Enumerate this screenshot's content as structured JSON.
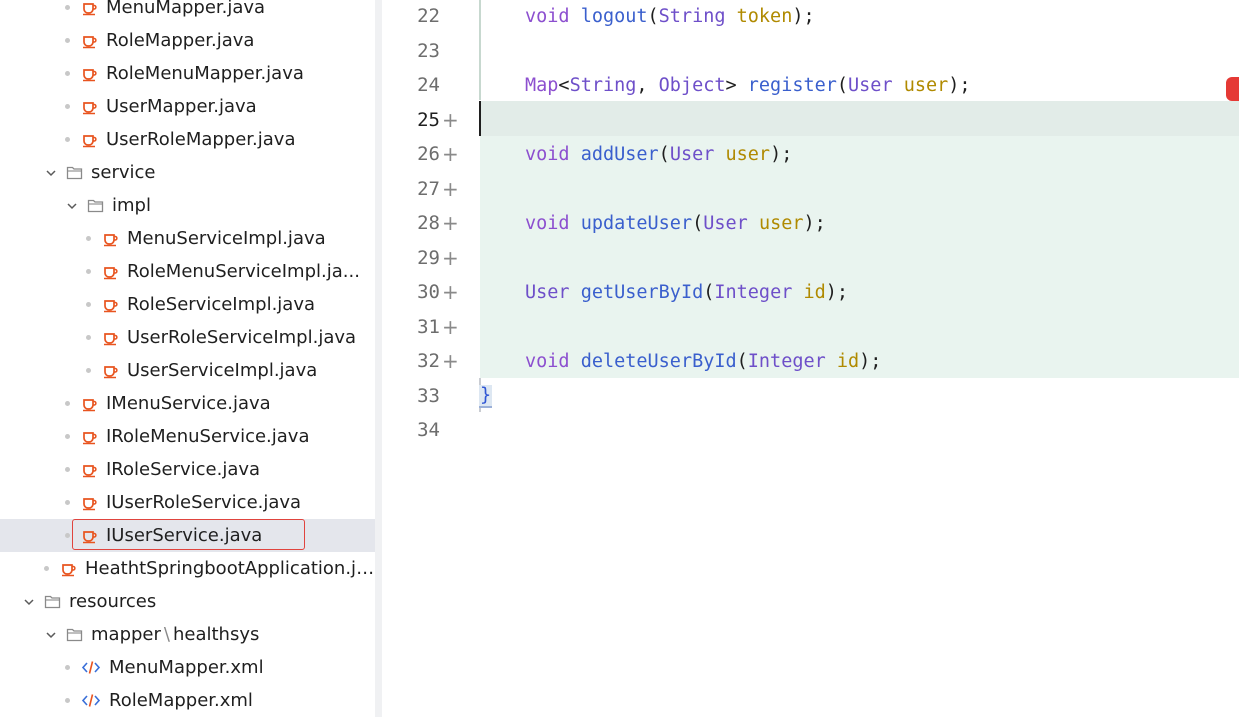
{
  "tree": {
    "items": [
      {
        "label": "MenuMapper.java",
        "type": "java",
        "indent": 3,
        "bullet": true
      },
      {
        "label": "RoleMapper.java",
        "type": "java",
        "indent": 3,
        "bullet": true
      },
      {
        "label": "RoleMenuMapper.java",
        "type": "java",
        "indent": 3,
        "bullet": true
      },
      {
        "label": "UserMapper.java",
        "type": "java",
        "indent": 3,
        "bullet": true
      },
      {
        "label": "UserRoleMapper.java",
        "type": "java",
        "indent": 3,
        "bullet": true
      },
      {
        "label": "service",
        "type": "folder",
        "indent": 2,
        "expanded": true
      },
      {
        "label": "impl",
        "type": "folder",
        "indent": 3,
        "expanded": true
      },
      {
        "label": "MenuServiceImpl.java",
        "type": "java",
        "indent": 4,
        "bullet": true
      },
      {
        "label": "RoleMenuServiceImpl.ja...",
        "type": "java",
        "indent": 4,
        "bullet": true
      },
      {
        "label": "RoleServiceImpl.java",
        "type": "java",
        "indent": 4,
        "bullet": true
      },
      {
        "label": "UserRoleServiceImpl.java",
        "type": "java",
        "indent": 4,
        "bullet": true
      },
      {
        "label": "UserServiceImpl.java",
        "type": "java",
        "indent": 4,
        "bullet": true
      },
      {
        "label": "IMenuService.java",
        "type": "java",
        "indent": 3,
        "bullet": true
      },
      {
        "label": "IRoleMenuService.java",
        "type": "java",
        "indent": 3,
        "bullet": true
      },
      {
        "label": "IRoleService.java",
        "type": "java",
        "indent": 3,
        "bullet": true
      },
      {
        "label": "IUserRoleService.java",
        "type": "java",
        "indent": 3,
        "bullet": true
      },
      {
        "label": "IUserService.java",
        "type": "java",
        "indent": 3,
        "bullet": true,
        "selected": true
      },
      {
        "label": "HeathtSpringbootApplication.ja...",
        "type": "java",
        "indent": 2,
        "bullet": true
      },
      {
        "label": "resources",
        "type": "folder",
        "indent": 1,
        "expanded": true
      },
      {
        "label": "mapper",
        "label2": "healthsys",
        "type": "folder",
        "indent": 2,
        "expanded": true
      },
      {
        "label": "MenuMapper.xml",
        "type": "xml",
        "indent": 3,
        "bullet": true
      },
      {
        "label": "RoleMapper.xml",
        "type": "xml",
        "indent": 3,
        "bullet": true
      }
    ],
    "path_separator": "\\"
  },
  "editor": {
    "lines": [
      {
        "num": "22",
        "tokens": [
          [
            "kw",
            "void "
          ],
          [
            "fn",
            "logout"
          ],
          [
            "bk",
            "("
          ],
          [
            "ty",
            "String "
          ],
          [
            "pm",
            "token"
          ],
          [
            "bk",
            ");"
          ]
        ]
      },
      {
        "num": "23",
        "tokens": []
      },
      {
        "num": "24",
        "tokens": [
          [
            "kw",
            "Map"
          ],
          [
            "bk",
            "<"
          ],
          [
            "ty",
            "String"
          ],
          [
            "bk",
            ", "
          ],
          [
            "ty",
            "Object"
          ],
          [
            "bk",
            "> "
          ],
          [
            "fn",
            "register"
          ],
          [
            "bk",
            "("
          ],
          [
            "ty",
            "User "
          ],
          [
            "pm",
            "user"
          ],
          [
            "bk",
            ");"
          ]
        ]
      },
      {
        "num": "25",
        "tokens": [],
        "changed": true,
        "current": true
      },
      {
        "num": "26",
        "tokens": [
          [
            "kw",
            "void "
          ],
          [
            "fn",
            "addUser"
          ],
          [
            "bk",
            "("
          ],
          [
            "ty",
            "User "
          ],
          [
            "pm",
            "user"
          ],
          [
            "bk",
            ");"
          ]
        ],
        "changed": true
      },
      {
        "num": "27",
        "tokens": [],
        "changed": true
      },
      {
        "num": "28",
        "tokens": [
          [
            "kw",
            "void "
          ],
          [
            "fn",
            "updateUser"
          ],
          [
            "bk",
            "("
          ],
          [
            "ty",
            "User "
          ],
          [
            "pm",
            "user"
          ],
          [
            "bk",
            ");"
          ]
        ],
        "changed": true
      },
      {
        "num": "29",
        "tokens": [],
        "changed": true
      },
      {
        "num": "30",
        "tokens": [
          [
            "ty",
            "User "
          ],
          [
            "fn",
            "getUserById"
          ],
          [
            "bk",
            "("
          ],
          [
            "ty",
            "Integer "
          ],
          [
            "pm",
            "id"
          ],
          [
            "bk",
            ");"
          ]
        ],
        "changed": true
      },
      {
        "num": "31",
        "tokens": [],
        "changed": true
      },
      {
        "num": "32",
        "tokens": [
          [
            "kw",
            "void "
          ],
          [
            "fn",
            "deleteUserById"
          ],
          [
            "bk",
            "("
          ],
          [
            "ty",
            "Integer "
          ],
          [
            "pm",
            "id"
          ],
          [
            "bk",
            ");"
          ]
        ],
        "changed": true
      },
      {
        "num": "33",
        "tokens": [
          [
            "brace",
            "}"
          ]
        ]
      },
      {
        "num": "34",
        "tokens": []
      }
    ],
    "change_marker": "+"
  },
  "colors": {
    "java_icon": "#e8541f",
    "folder_icon": "#8a8a8a",
    "xml_icon": "#3a6fd8",
    "selection_border": "#e0443e",
    "error_stripe": "#e53935"
  }
}
